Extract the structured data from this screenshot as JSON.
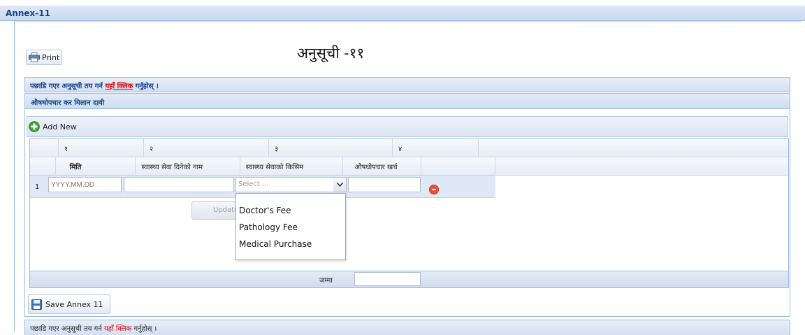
{
  "annex": {
    "title": "Annex-11"
  },
  "print_button": {
    "label": "Print"
  },
  "page_title": "अनुसूची -११",
  "notice": {
    "prefix": "पछाडि गएर अनुसूची तय गर्न",
    "link": "यहाँ क्लिक",
    "suffix": "गर्नुहोस् ।"
  },
  "panel": {
    "title": "औषधोपचार कर मिलान दावी"
  },
  "toolbar": {
    "add_label": "Add New"
  },
  "grid": {
    "column_numbers": [
      "१",
      "२",
      "३",
      "४"
    ],
    "columns": [
      "मिति",
      "स्वास्थ्य सेवा दिनेको नाम",
      "स्वास्थ्य सेवाको किसिम",
      "औषधोपचार खर्च"
    ],
    "rows": [
      {
        "number": "1",
        "date_placeholder": "YYYY.MM.DD",
        "provider": "",
        "service_type": "Select ...",
        "amount": ""
      }
    ],
    "update_label": "Update",
    "total_label": "जम्मा",
    "total_value": ""
  },
  "dropdown": {
    "options": [
      "Doctor's Fee",
      "Pathology Fee",
      "Medical Purchase"
    ]
  },
  "save_button": {
    "label": "Save Annex 11"
  },
  "colors": {
    "accent": "#15428b",
    "link": "#e00000",
    "border": "#99bbe8"
  },
  "icons": {
    "print": "printer-icon",
    "add": "plus-circle-icon",
    "remove": "minus-circle-icon",
    "save": "floppy-disk-icon",
    "combo": "chevron-down-icon"
  }
}
